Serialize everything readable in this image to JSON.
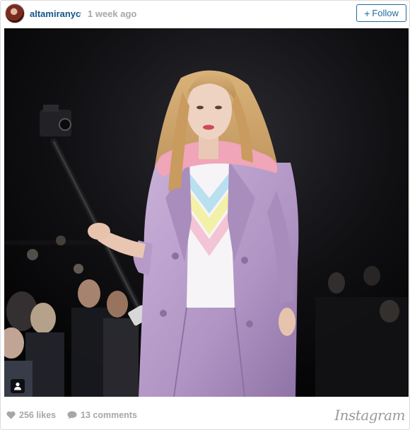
{
  "post": {
    "username": "altamiranyc",
    "separator": "•",
    "time_ago": "1 week ago",
    "follow_label": "Follow",
    "follow_plus": "+"
  },
  "photo": {
    "subject": "runway-model-with-camera-stabilizer",
    "user_tag_icon": "person-icon"
  },
  "footer": {
    "likes": "256 likes",
    "comments": "13 comments",
    "brand": "Instagram",
    "heart_icon": "heart-icon",
    "comment_icon": "comment-bubble-icon"
  },
  "colors": {
    "link_blue": "#125688",
    "follow_blue": "#1f6b9c",
    "muted_gray": "#a5a7aa",
    "coat_lilac": "#b89bc9",
    "collar_pink": "#f0a5b8"
  }
}
